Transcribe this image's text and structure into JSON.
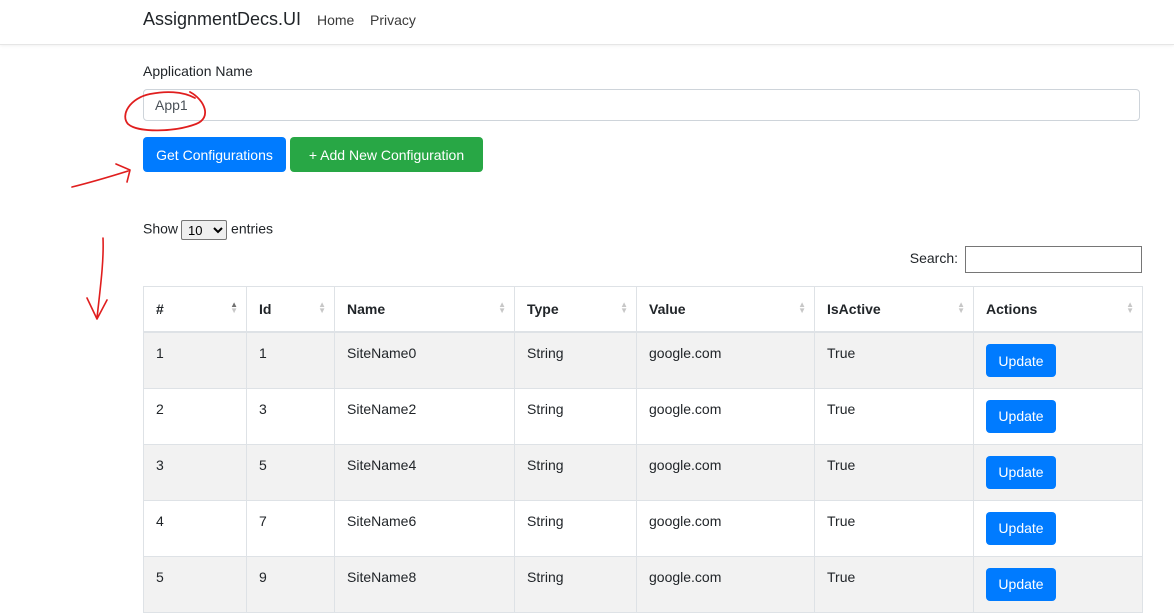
{
  "navbar": {
    "brand": "AssignmentDecs.UI",
    "links": [
      "Home",
      "Privacy"
    ]
  },
  "form": {
    "label": "Application Name",
    "app_name_value": "App1",
    "get_button": "Get Configurations",
    "add_button": "+  Add New Configuration"
  },
  "table_controls": {
    "show_label": "Show",
    "entries_label": "entries",
    "page_length": "10",
    "search_label": "Search:"
  },
  "table": {
    "columns": [
      "#",
      "Id",
      "Name",
      "Type",
      "Value",
      "IsActive",
      "Actions"
    ],
    "rows": [
      [
        "1",
        "1",
        "SiteName0",
        "String",
        "google.com",
        "True",
        "Update"
      ],
      [
        "2",
        "3",
        "SiteName2",
        "String",
        "google.com",
        "True",
        "Update"
      ],
      [
        "3",
        "5",
        "SiteName4",
        "String",
        "google.com",
        "True",
        "Update"
      ],
      [
        "4",
        "7",
        "SiteName6",
        "String",
        "google.com",
        "True",
        "Update"
      ],
      [
        "5",
        "9",
        "SiteName8",
        "String",
        "google.com",
        "True",
        "Update"
      ]
    ]
  },
  "colors": {
    "primary": "#007bff",
    "success": "#28a745",
    "annotation": "#e01e1e"
  }
}
